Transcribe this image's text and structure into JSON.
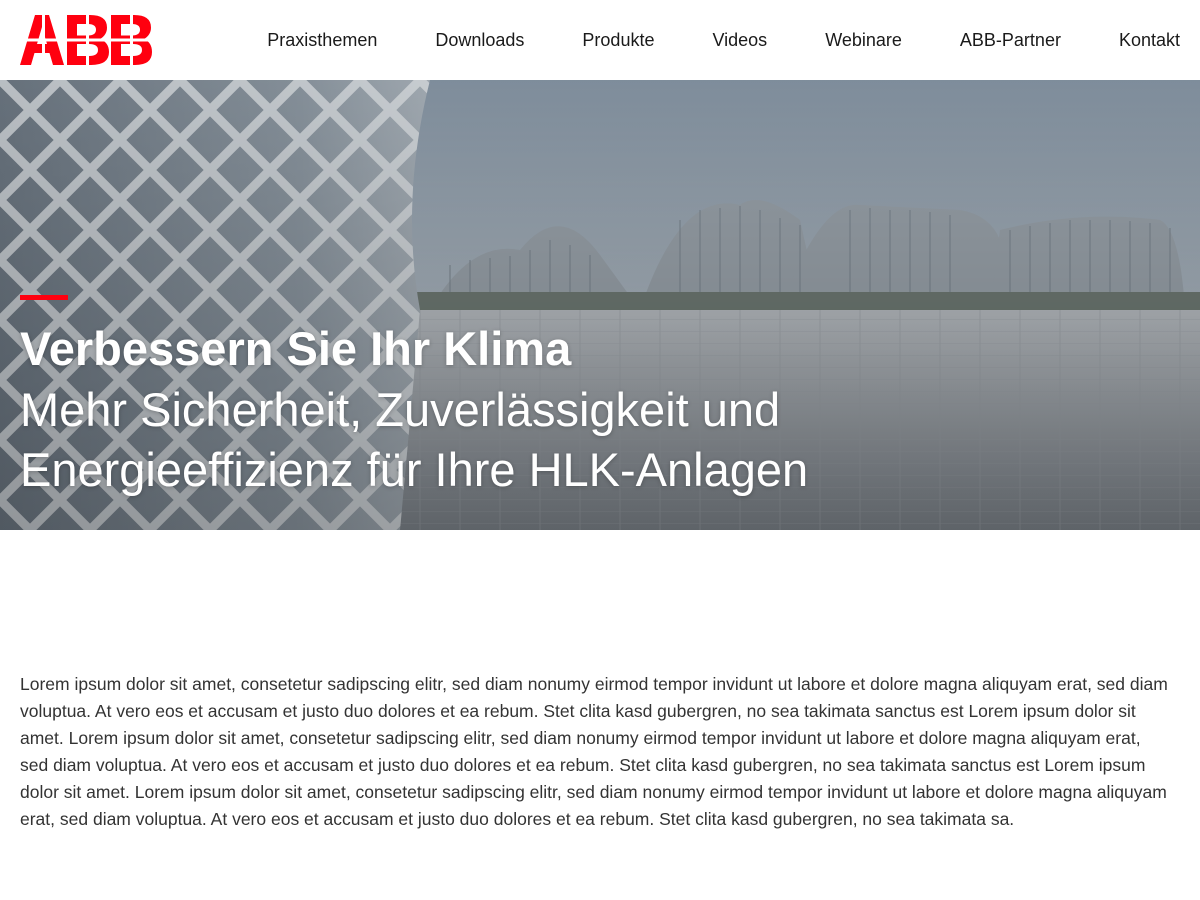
{
  "brand": {
    "logo_text": "ABB",
    "logo_color": "#ff000f"
  },
  "nav": {
    "items": [
      {
        "label": "Praxisthemen"
      },
      {
        "label": "Downloads"
      },
      {
        "label": "Produkte"
      },
      {
        "label": "Videos"
      },
      {
        "label": "Webinare"
      },
      {
        "label": "ABB-Partner"
      },
      {
        "label": "Kontakt"
      }
    ]
  },
  "hero": {
    "title": "Verbessern Sie Ihr Klima",
    "subtitle_line1": "Mehr Sicherheit, Zuverlässigkeit und",
    "subtitle_line2": "Energieeffizienz für Ihre HLK-Anlagen",
    "accent_color": "#ff000f",
    "image": "architecture-photo-modern-buildings-plaza"
  },
  "content": {
    "paragraph": "Lorem ipsum dolor sit amet, consetetur sadipscing elitr, sed diam nonumy eirmod tempor invidunt ut labore et dolore magna aliquyam erat, sed diam voluptua. At vero eos et accusam et justo duo dolores et ea rebum. Stet clita kasd gubergren, no sea takimata sanctus est Lorem ipsum dolor sit amet. Lorem ipsum dolor sit amet, consetetur sadipscing elitr, sed diam nonumy eirmod tempor invidunt ut labore et dolore magna aliquyam erat, sed diam voluptua. At vero eos et accusam et justo duo dolores et ea rebum. Stet clita kasd gubergren, no sea takimata sanctus est Lorem ipsum dolor sit amet. Lorem ipsum dolor sit amet, consetetur sadipscing elitr, sed diam nonumy eirmod tempor invidunt ut labore et dolore magna aliquyam erat, sed diam voluptua. At vero eos et accusam et justo duo dolores et ea rebum. Stet clita kasd gubergren, no sea takimata sa."
  }
}
